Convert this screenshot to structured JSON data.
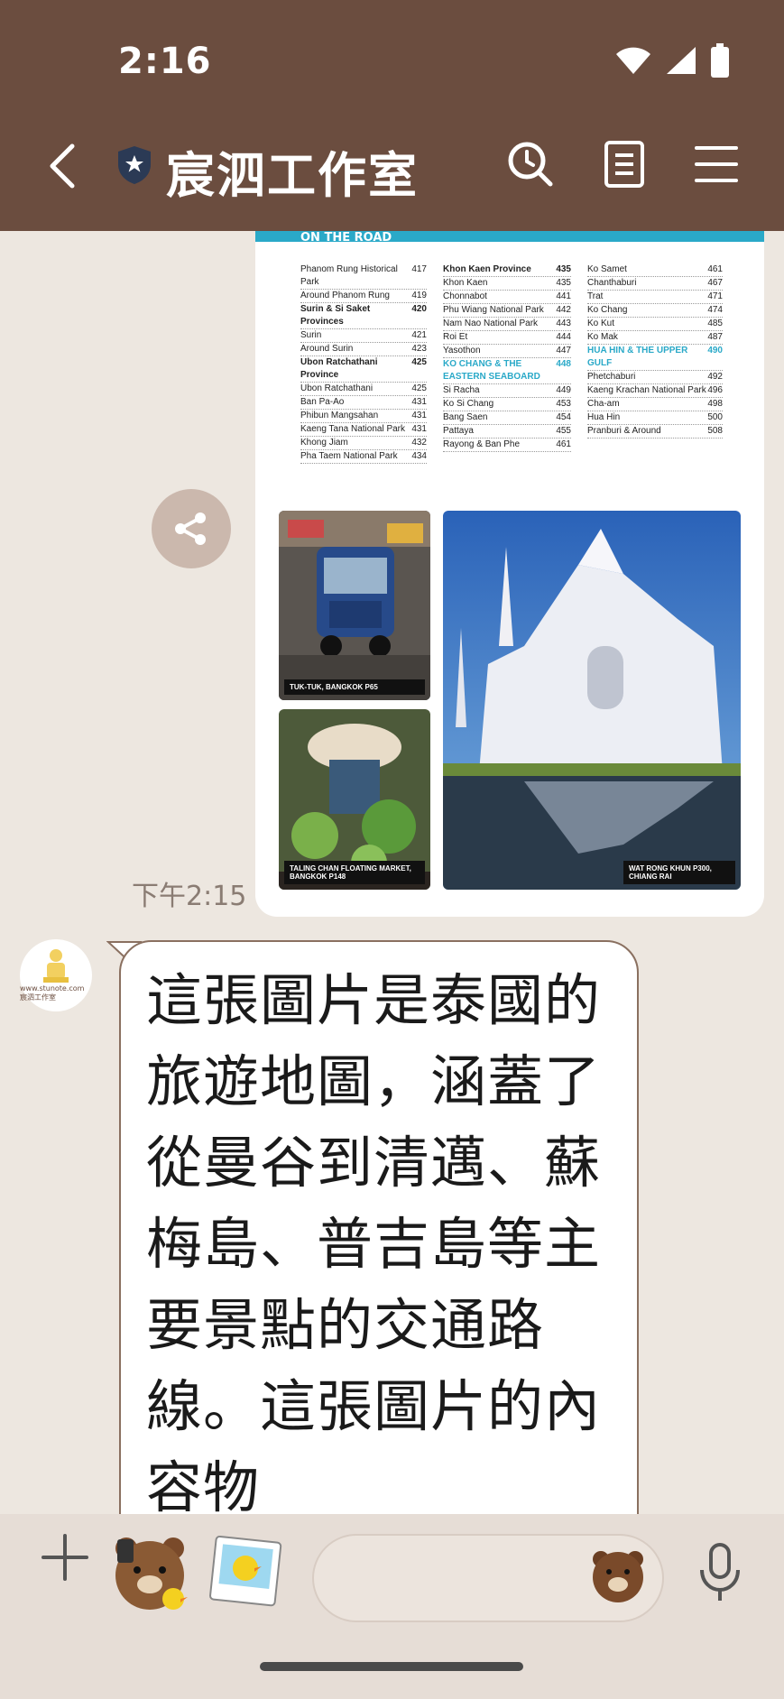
{
  "status_bar": {
    "time": "2:16"
  },
  "header": {
    "title": "宸泗工作室"
  },
  "chat": {
    "image_message": {
      "timestamp": "下午2:15",
      "page_header": "ON THE ROAD",
      "toc_columns": [
        [
          {
            "label": "Phanom Rung Historical Park",
            "page": "417"
          },
          {
            "label": "Around Phanom Rung",
            "page": "419"
          },
          {
            "label": "Surin & Si Saket Provinces",
            "page": "420",
            "head": true
          },
          {
            "label": "Surin",
            "page": "421"
          },
          {
            "label": "Around Surin",
            "page": "423"
          },
          {
            "label": "Ubon Ratchathani Province",
            "page": "425",
            "head": true
          },
          {
            "label": "Ubon Ratchathani",
            "page": "425"
          },
          {
            "label": "Ban Pa-Ao",
            "page": "431"
          },
          {
            "label": "Phibun Mangsahan",
            "page": "431"
          },
          {
            "label": "Kaeng Tana National Park",
            "page": "431"
          },
          {
            "label": "Khong Jiam",
            "page": "432"
          },
          {
            "label": "Pha Taem National Park",
            "page": "434"
          }
        ],
        [
          {
            "label": "Khon Kaen Province",
            "page": "435",
            "head": true
          },
          {
            "label": "Khon Kaen",
            "page": "435"
          },
          {
            "label": "Chonnabot",
            "page": "441"
          },
          {
            "label": "Phu Wiang National Park",
            "page": "442"
          },
          {
            "label": "Nam Nao National Park",
            "page": "443"
          },
          {
            "label": "Roi Et",
            "page": "444"
          },
          {
            "label": "Yasothon",
            "page": "447"
          },
          {
            "label": "KO CHANG & THE EASTERN SEABOARD",
            "page": "448",
            "blue": true
          },
          {
            "label": "Si Racha",
            "page": "449"
          },
          {
            "label": "Ko Si Chang",
            "page": "453"
          },
          {
            "label": "Bang Saen",
            "page": "454"
          },
          {
            "label": "Pattaya",
            "page": "455"
          },
          {
            "label": "Rayong & Ban Phe",
            "page": "461"
          }
        ],
        [
          {
            "label": "Ko Samet",
            "page": "461"
          },
          {
            "label": "Chanthaburi",
            "page": "467"
          },
          {
            "label": "Trat",
            "page": "471"
          },
          {
            "label": "Ko Chang",
            "page": "474"
          },
          {
            "label": "Ko Kut",
            "page": "485"
          },
          {
            "label": "Ko Mak",
            "page": "487"
          },
          {
            "label": "HUA HIN & THE UPPER GULF",
            "page": "490",
            "blue": true
          },
          {
            "label": "Phetchaburi",
            "page": "492"
          },
          {
            "label": "Kaeng Krachan National Park",
            "page": "496"
          },
          {
            "label": "Cha-am",
            "page": "498"
          },
          {
            "label": "Hua Hin",
            "page": "500"
          },
          {
            "label": "Pranburi & Around",
            "page": "508"
          }
        ]
      ],
      "captions": {
        "photo1": "TUK-TUK, BANGKOK P65",
        "photo2": "TALING CHAN FLOATING MARKET, BANGKOK P148",
        "photo3": "WAT RONG KHUN P300, CHIANG RAI"
      }
    },
    "avatar_text": "www.stunote.com 宸泗工作室",
    "reply_text": "這張圖片是泰國的旅遊地圖，涵蓋了從曼谷到清邁、蘇梅島、普吉島等主要景點的交通路線。這張圖片的內容物"
  },
  "colors": {
    "header_bg": "#6b4d3f",
    "chat_bg": "#ede7e0",
    "bubble_border": "#8a7060",
    "accent_blue": "#2aa9c8"
  }
}
